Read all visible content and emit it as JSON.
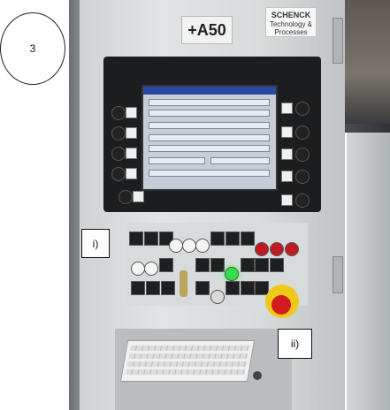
{
  "annotation": {
    "number": "3",
    "label_i": "i)",
    "label_ii": "ii)"
  },
  "panel": {
    "tag": "+A50",
    "brand_name": "SCHENCK",
    "brand_tagline": "Technology & Processes"
  }
}
